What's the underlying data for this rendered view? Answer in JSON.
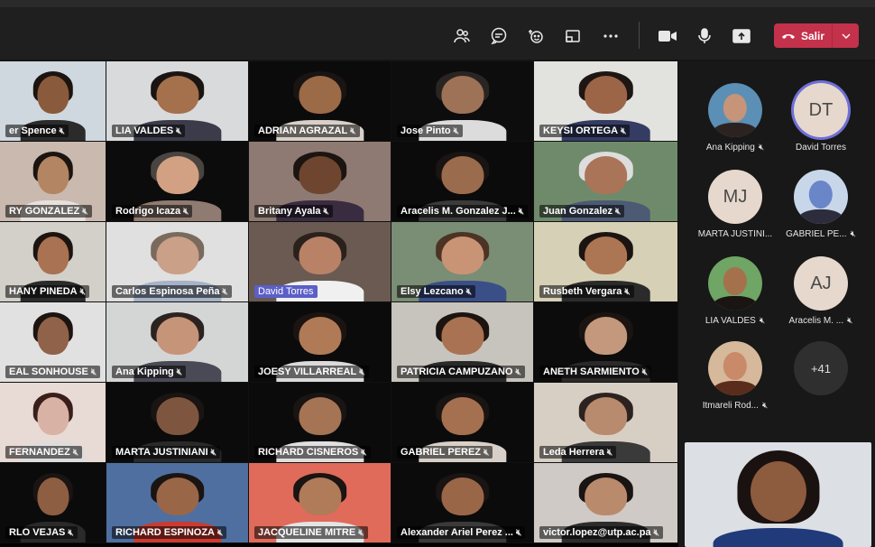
{
  "toolbar": {
    "leave_label": "Salir",
    "icons": [
      "participants-icon",
      "chat-icon",
      "reactions-icon",
      "rooms-icon",
      "more-icon",
      "camera-icon",
      "mic-icon",
      "share-icon"
    ]
  },
  "tiles": [
    {
      "name": "er Spence",
      "bg": "#cfd8de",
      "skin": "#8a5a3c",
      "hair": "#1c1410",
      "shirt": "#2b2b2b"
    },
    {
      "name": "LIA VALDES",
      "bg": "#d9dadb",
      "skin": "#a5704c",
      "hair": "#1a1412",
      "shirt": "#3b3b4a"
    },
    {
      "name": "ADRIAN AGRAZAL",
      "bg": "#0b0b0b",
      "skin": "#9b6a46",
      "hair": "#1a1412",
      "shirt": "#d8d0c8"
    },
    {
      "name": "Jose Pinto",
      "bg": "#0d0d0d",
      "skin": "#9d7256",
      "hair": "#2a2522",
      "shirt": "#dcdcdc"
    },
    {
      "name": "KEYSI ORTEGA",
      "bg": "#e2e2df",
      "skin": "#9c6548",
      "hair": "#1e1612",
      "shirt": "#343c64"
    },
    {
      "name": "RY GONZALEZ",
      "bg": "#c9b9ae",
      "skin": "#b38563",
      "hair": "#1c1410",
      "shirt": "#e6e1dc"
    },
    {
      "name": "Rodrigo Icaza",
      "bg": "#0c0c0c",
      "skin": "#d2a183",
      "hair": "#4a4440",
      "shirt": "#8f7b71"
    },
    {
      "name": "Britany Ayala",
      "bg": "#8e7a72",
      "skin": "#6e4630",
      "hair": "#1c1410",
      "shirt": "#3a2c40"
    },
    {
      "name": "Aracelis M. Gonzalez J...",
      "bg": "#0b0b0b",
      "skin": "#9a6b4d",
      "hair": "#1a1412",
      "shirt": "#3b3b3b"
    },
    {
      "name": "Juan Gonzalez",
      "bg": "#6f8a6b",
      "skin": "#a97458",
      "hair": "#ddd",
      "shirt": "#4c5a74"
    },
    {
      "name": "HANY PINEDA",
      "bg": "#d3d0ca",
      "skin": "#a97252",
      "hair": "#1c1410",
      "shirt": "#2b2b2b"
    },
    {
      "name": "Carlos Espinosa Peña",
      "bg": "#dfe0df",
      "skin": "#caa088",
      "hair": "#7a6a5e",
      "shirt": "#a5b2c8"
    },
    {
      "name": "David Torres",
      "bg": "#6a5a52",
      "skin": "#b98266",
      "hair": "#2a211c",
      "shirt": "#f0f0f0",
      "hl": true
    },
    {
      "name": "Elsy Lezcano",
      "bg": "#7a8d75",
      "skin": "#c99475",
      "hair": "#4c3324",
      "shirt": "#3a4f87"
    },
    {
      "name": "Rusbeth Vergara",
      "bg": "#d6d0b6",
      "skin": "#ac7654",
      "hair": "#1c1410",
      "shirt": "#2b2b2b"
    },
    {
      "name": "EAL SONHOUSE",
      "bg": "#e1e1e1",
      "skin": "#90624a",
      "hair": "#1c1410",
      "shirt": "#e0e0e0"
    },
    {
      "name": "Ana Kipping",
      "bg": "#d4d6d6",
      "skin": "#c69478",
      "hair": "#2c2320",
      "shirt": "#4a4a56"
    },
    {
      "name": "JOESY VILLARREAL",
      "bg": "#0b0b0b",
      "skin": "#b07a57",
      "hair": "#1c1410",
      "shirt": "#dbdbdb"
    },
    {
      "name": "PATRICIA CAMPUZANO",
      "bg": "#c7c3bd",
      "skin": "#a97252",
      "hair": "#1c1410",
      "shirt": "#2a2a2a"
    },
    {
      "name": "ANETH SARMIENTO",
      "bg": "#0c0c0c",
      "skin": "#c4987c",
      "hair": "#1c1410",
      "shirt": "#2a2a2a"
    },
    {
      "name": "FERNANDEZ",
      "bg": "#e8dad4",
      "skin": "#d8b3a5",
      "hair": "#3a1e1a",
      "shirt": "#ddd"
    },
    {
      "name": "MARTA JUSTINIANI",
      "bg": "#0b0b0b",
      "skin": "#7e5640",
      "hair": "#1a1412",
      "shirt": "#2a2a2a"
    },
    {
      "name": "RICHARD CISNEROS",
      "bg": "#0b0b0b",
      "skin": "#a47455",
      "hair": "#1a1412",
      "shirt": "#e0e0e0"
    },
    {
      "name": "GABRIEL PEREZ",
      "bg": "#0b0b0b",
      "skin": "#a57050",
      "hair": "#1a1412",
      "shirt": "#d8d0c8"
    },
    {
      "name": "Leda Herrera",
      "bg": "#d7cfc4",
      "skin": "#b88a6e",
      "hair": "#2c2320",
      "shirt": "#3a3a3a"
    },
    {
      "name": "RLO VEJAS",
      "bg": "#0b0b0b",
      "skin": "#8e5e42",
      "hair": "#1a1412",
      "shirt": "#2a2a2a"
    },
    {
      "name": "RICHARD ESPINOZA",
      "bg": "#4f6fa0",
      "skin": "#9a6648",
      "hair": "#1a1412",
      "shirt": "#cc3a30"
    },
    {
      "name": "JACQUELINE MITRE",
      "bg": "#e06b5a",
      "skin": "#b07b58",
      "hair": "#1a1412",
      "shirt": "#e4e4e4"
    },
    {
      "name": "Alexander Ariel Perez ...",
      "bg": "#0b0b0b",
      "skin": "#9a6648",
      "hair": "#1a1412",
      "shirt": "#3a3a3a"
    },
    {
      "name": "victor.lopez@utp.ac.pa",
      "bg": "#cfcac5",
      "skin": "#b98a6c",
      "hair": "#1a1412",
      "shirt": "#2c2c2c"
    }
  ],
  "sidebar": {
    "people": [
      {
        "name": "Ana Kipping",
        "type": "photo",
        "skin": "#c69478",
        "hair": "#2c2320",
        "bg": "#5b8fb5",
        "muted": true
      },
      {
        "name": "David Torres",
        "type": "initials",
        "initials": "DT",
        "ring": true,
        "muted": false
      },
      {
        "name": "MARTA JUSTINI...",
        "type": "initials",
        "initials": "MJ",
        "muted": false
      },
      {
        "name": "GABRIEL PE...",
        "type": "photo",
        "skin": "#6a86c8",
        "hair": "#2c2c3c",
        "bg": "#c8d6ea",
        "muted": true
      },
      {
        "name": "LIA VALDES",
        "type": "photo",
        "skin": "#a5704c",
        "hair": "#1a1412",
        "bg": "#6fa565",
        "muted": true
      },
      {
        "name": "Aracelis M. ...",
        "type": "initials",
        "initials": "AJ",
        "muted": true
      },
      {
        "name": "Itmareli Rod...",
        "type": "photo",
        "skin": "#c98a6a",
        "hair": "#5a2c1c",
        "bg": "#d6b89a",
        "muted": true
      }
    ],
    "more_count": "+41"
  },
  "self_view": {
    "bg": "#dcdfe4",
    "skin": "#8d5b3e",
    "hair": "#1a1210",
    "shirt": "#203a7a"
  }
}
